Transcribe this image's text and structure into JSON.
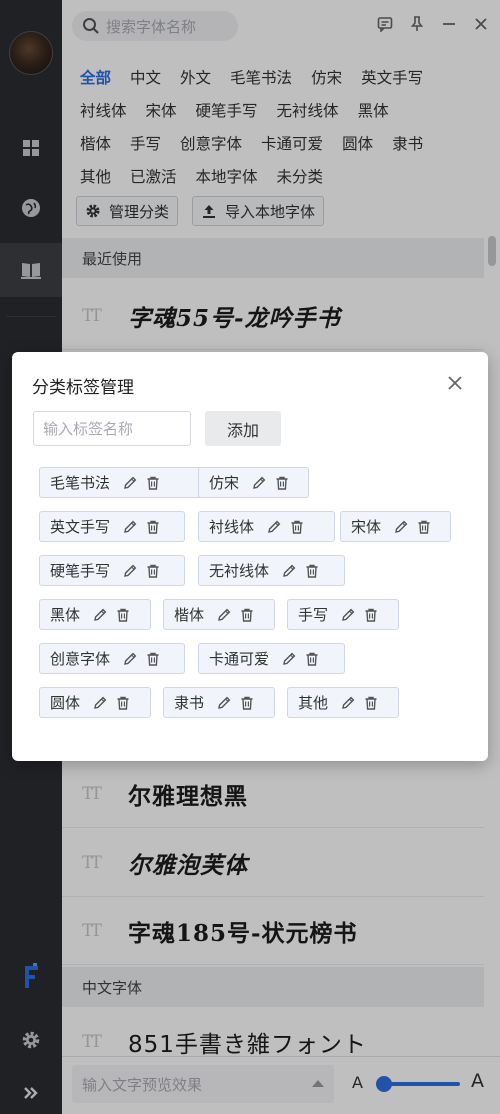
{
  "search": {
    "placeholder": "搜索字体名称"
  },
  "categories": [
    [
      "全部",
      "中文",
      "外文",
      "毛笔书法",
      "仿宋",
      "英文手写"
    ],
    [
      "衬线体",
      "宋体",
      "硬笔手写",
      "无衬线体",
      "黑体"
    ],
    [
      "楷体",
      "手写",
      "创意字体",
      "卡通可爱",
      "圆体",
      "隶书"
    ],
    [
      "其他",
      "已激活",
      "本地字体",
      "未分类"
    ]
  ],
  "toolbar": {
    "manage_label": "管理分类",
    "import_label": "导入本地字体"
  },
  "sections": {
    "recent": "最近使用",
    "chinese": "中文字体"
  },
  "tt_glyph": "TT",
  "fonts": {
    "top": "字魂55号-龙吟手书",
    "row1": "尔雅理想黑",
    "row2": "尔雅泡芙体",
    "row3": "字魂185号-状元榜书",
    "row4": "851手書き雑フォント"
  },
  "preview": {
    "placeholder": "输入文字预览效果",
    "small_a": "A",
    "large_a": "A",
    "size_level": 0.05
  },
  "modal": {
    "title": "分类标签管理",
    "input_placeholder": "输入标签名称",
    "add_label": "添加",
    "tags": [
      "毛笔书法",
      "仿宋",
      "英文手写",
      "衬线体",
      "宋体",
      "硬笔手写",
      "无衬线体",
      "黑体",
      "楷体",
      "手写",
      "创意字体",
      "卡通可爱",
      "圆体",
      "隶书",
      "其他"
    ]
  },
  "colors": {
    "accent": "#2f6fe0",
    "rail": "#2b2d31"
  },
  "icons": [
    "grid-icon",
    "globe-icon",
    "book-icon",
    "font-logo-icon",
    "gear-icon",
    "expand-icon",
    "search-icon",
    "feedback-icon",
    "pin-icon",
    "minimize-icon",
    "close-icon",
    "edit-icon",
    "trash-icon",
    "upload-icon"
  ]
}
